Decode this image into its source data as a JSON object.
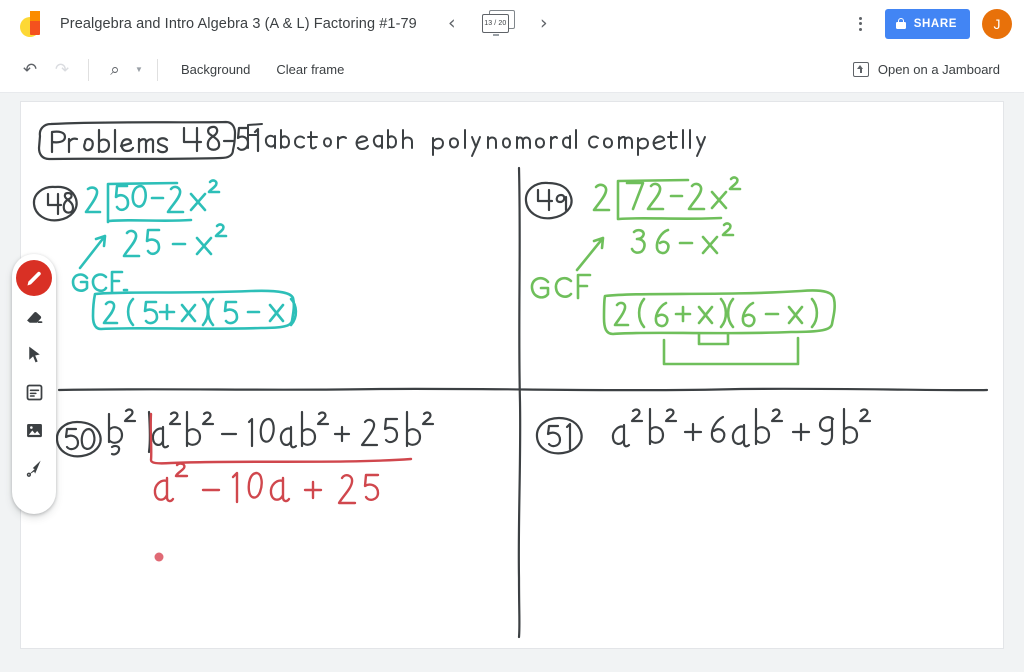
{
  "app": {
    "name": "Jamboard",
    "logo_yellow": "#FDD835",
    "logo_orange": "#F4511E"
  },
  "topbar": {
    "title": "Prealgebra and Intro Algebra 3 (A & L) Factoring #1-79",
    "prev_frame_label": "‹",
    "next_frame_label": "›",
    "frame_counter": "13 / 20",
    "more_options_label": "More options",
    "share_label": "SHARE",
    "avatar_initial": "J",
    "share_color": "#4285f4",
    "avatar_color": "#E8710A"
  },
  "toolbar": {
    "undo_label": "↶",
    "redo_label": "↷",
    "zoom_label": "⌕",
    "zoom_caret": "▼",
    "background_label": "Background",
    "clear_frame_label": "Clear frame",
    "open_jamboard_label": "Open on a Jamboard"
  },
  "palette": {
    "tools": [
      {
        "name": "pen",
        "label": "Pen",
        "active": true
      },
      {
        "name": "eraser",
        "label": "Eraser",
        "active": false
      },
      {
        "name": "select",
        "label": "Select",
        "active": false
      },
      {
        "name": "sticky-note",
        "label": "Sticky note",
        "active": false
      },
      {
        "name": "image",
        "label": "Add image",
        "active": false
      },
      {
        "name": "laser",
        "label": "Laser pointer",
        "active": false
      }
    ],
    "active_color": "#D93025"
  },
  "canvas": {
    "ink_colors": {
      "black": "#3c4043",
      "teal": "#2DBFB8",
      "green": "#6FBF5B",
      "red": "#D0474D",
      "dot_pink": "#E06A75"
    },
    "header_banner": "Problems 48-51",
    "instruction": "Factor each polynomial completely",
    "problems": [
      {
        "number": "48",
        "color": "teal",
        "gcf_label": "GCF",
        "divisor": "2",
        "expression": "50 - 2x²",
        "quotient": "25 - x²",
        "answer": "2 (5 + x)(5 - x)"
      },
      {
        "number": "49",
        "color": "green",
        "gcf_label": "GCF",
        "divisor": "2",
        "expression": "72 - 2x²",
        "quotient": "36 - x²",
        "answer": "2 (6 + x)(6 - x)"
      },
      {
        "number": "50",
        "color": "red",
        "gcf_label": "",
        "divisor": "b²",
        "expression": "a²b² - 10ab² + 25b²",
        "quotient": "a² - 10a + 25",
        "answer": ""
      },
      {
        "number": "51",
        "color": "black",
        "gcf_label": "",
        "divisor": "",
        "expression": "a²b² + 6ab² + 9b²",
        "quotient": "",
        "answer": ""
      }
    ]
  }
}
